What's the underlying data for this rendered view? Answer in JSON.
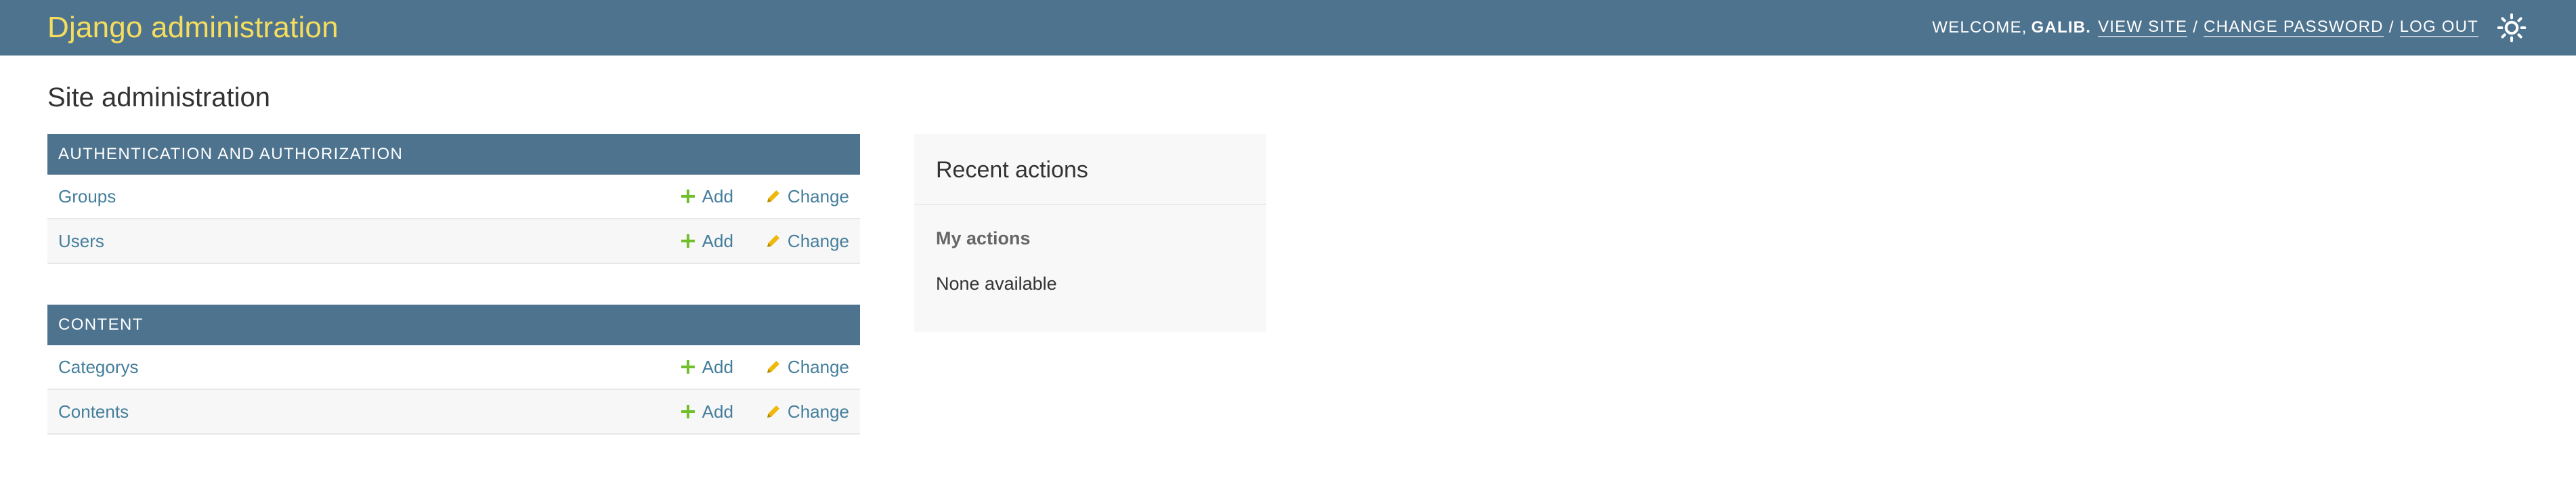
{
  "header": {
    "branding": "Django administration",
    "welcome": "WELCOME,",
    "username": "GALIB.",
    "view_site": "VIEW SITE",
    "separator": "/",
    "change_password": "CHANGE PASSWORD",
    "log_out": "LOG OUT",
    "theme_icon": "sun-icon"
  },
  "page_title": "Site administration",
  "modules": [
    {
      "caption": "AUTHENTICATION AND AUTHORIZATION",
      "models": [
        {
          "name": "Groups",
          "add": "Add",
          "change": "Change"
        },
        {
          "name": "Users",
          "add": "Add",
          "change": "Change"
        }
      ]
    },
    {
      "caption": "CONTENT",
      "models": [
        {
          "name": "Categorys",
          "add": "Add",
          "change": "Change"
        },
        {
          "name": "Contents",
          "add": "Add",
          "change": "Change"
        }
      ]
    }
  ],
  "recent_actions": {
    "title": "Recent actions",
    "subtitle": "My actions",
    "empty": "None available"
  },
  "colors": {
    "header_bg": "#4e738f",
    "branding": "#f5dd5d",
    "link": "#447e9b",
    "add_icon": "#70bf2b",
    "change_icon": "#efb80b"
  }
}
